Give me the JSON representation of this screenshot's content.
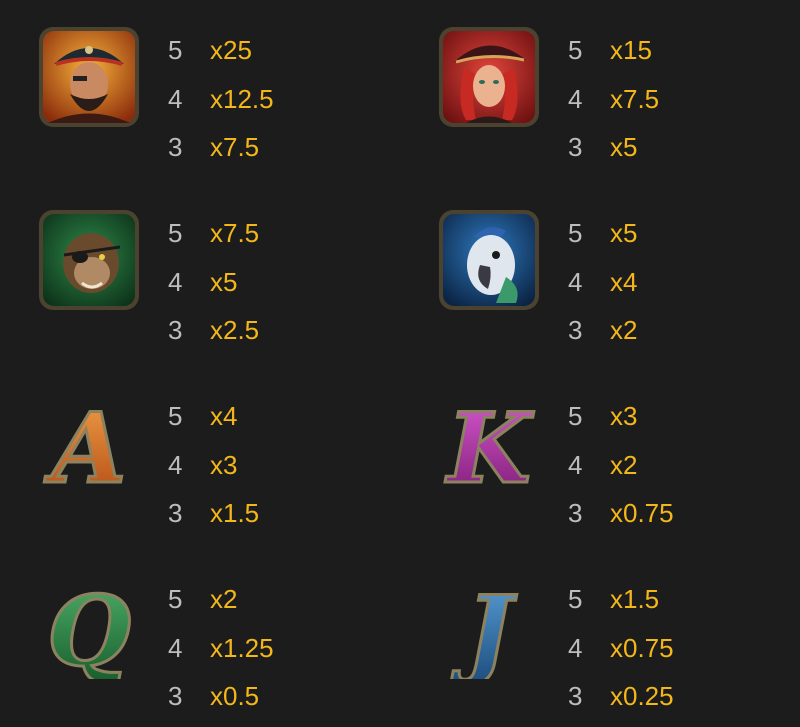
{
  "colors": {
    "background": "#1c1c1c",
    "count_text": "#bdbdbd",
    "multiplier_text": "#f4b71a"
  },
  "symbols": [
    {
      "icon": "pirate-captain-icon",
      "payouts": [
        {
          "count": "5",
          "multiplier": "x25"
        },
        {
          "count": "4",
          "multiplier": "x12.5"
        },
        {
          "count": "3",
          "multiplier": "x7.5"
        }
      ]
    },
    {
      "icon": "pirate-woman-icon",
      "payouts": [
        {
          "count": "5",
          "multiplier": "x15"
        },
        {
          "count": "4",
          "multiplier": "x7.5"
        },
        {
          "count": "3",
          "multiplier": "x5"
        }
      ]
    },
    {
      "icon": "monkey-eyepatch-icon",
      "payouts": [
        {
          "count": "5",
          "multiplier": "x7.5"
        },
        {
          "count": "4",
          "multiplier": "x5"
        },
        {
          "count": "3",
          "multiplier": "x2.5"
        }
      ]
    },
    {
      "icon": "parrot-icon",
      "payouts": [
        {
          "count": "5",
          "multiplier": "x5"
        },
        {
          "count": "4",
          "multiplier": "x4"
        },
        {
          "count": "3",
          "multiplier": "x2"
        }
      ]
    },
    {
      "icon": "letter-a-icon",
      "letter": "A",
      "payouts": [
        {
          "count": "5",
          "multiplier": "x4"
        },
        {
          "count": "4",
          "multiplier": "x3"
        },
        {
          "count": "3",
          "multiplier": "x1.5"
        }
      ]
    },
    {
      "icon": "letter-k-icon",
      "letter": "K",
      "payouts": [
        {
          "count": "5",
          "multiplier": "x3"
        },
        {
          "count": "4",
          "multiplier": "x2"
        },
        {
          "count": "3",
          "multiplier": "x0.75"
        }
      ]
    },
    {
      "icon": "letter-q-icon",
      "letter": "Q",
      "payouts": [
        {
          "count": "5",
          "multiplier": "x2"
        },
        {
          "count": "4",
          "multiplier": "x1.25"
        },
        {
          "count": "3",
          "multiplier": "x0.5"
        }
      ]
    },
    {
      "icon": "letter-j-icon",
      "letter": "J",
      "payouts": [
        {
          "count": "5",
          "multiplier": "x1.5"
        },
        {
          "count": "4",
          "multiplier": "x0.75"
        },
        {
          "count": "3",
          "multiplier": "x0.25"
        }
      ]
    }
  ]
}
